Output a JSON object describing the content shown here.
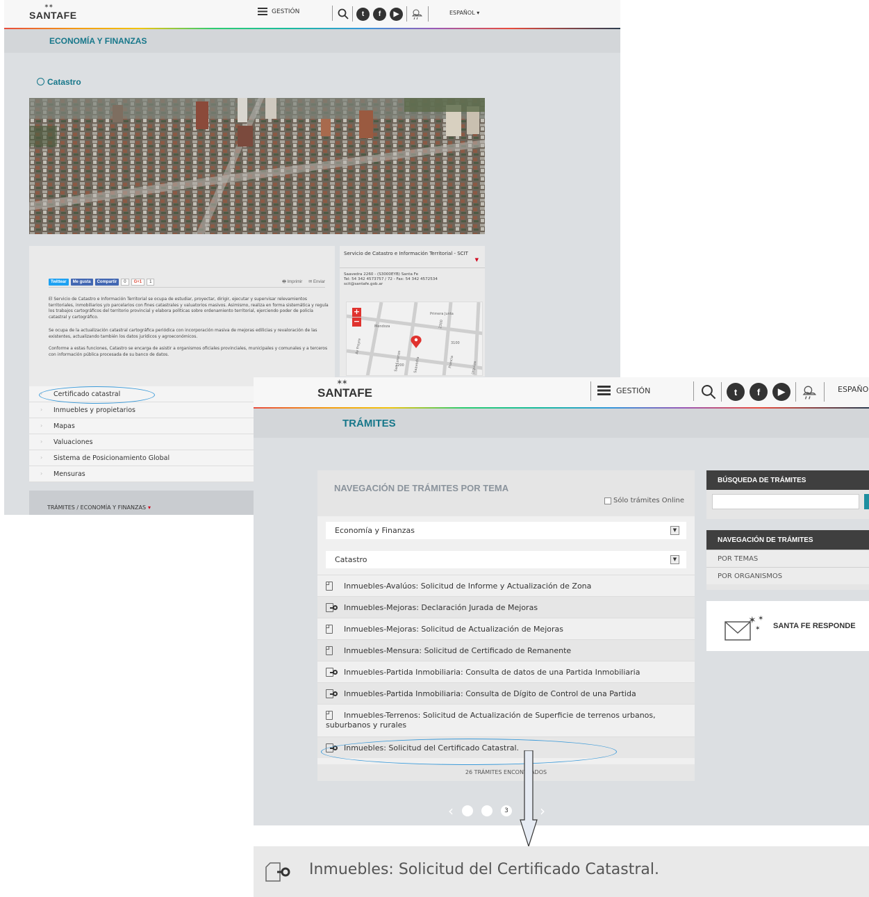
{
  "colors": {
    "teal": "#17778a",
    "panel": "#dcdfe2",
    "dark_header": "#3f3f3f",
    "red": "#d0021b",
    "annotation": "#3a9ad9"
  },
  "header": {
    "logo": "SANTAFE",
    "menu_label": "GESTIÓN",
    "language": "ESPAÑOL ▾",
    "language_short": "ESPAÑO",
    "icons": [
      "menu-icon",
      "search-icon",
      "twitter-icon",
      "facebook-icon",
      "youtube-icon",
      "weather-icon"
    ]
  },
  "page1": {
    "section": "ECONOMÍA Y FINANZAS",
    "breadcrumb": "Catastro",
    "share": {
      "tweet": "Twittear",
      "like": "Me gusta",
      "share": "Compartir",
      "share_count": "0",
      "gplus": "G+1",
      "gplus_count": "1",
      "print": "Imprimir",
      "send": "Enviar"
    },
    "paragraphs": [
      "El Servicio de Catastro e Información Territorial se ocupa de estudiar, proyectar, dirigir, ejecutar y supervisar relevamientos territoriales, inmobiliarios y/o parcelarios con fines catastrales y valuatorios masivos. Asimismo, realiza en forma sistemática y regula los trabajos cartográficos del territorio provincial y elabora políticas sobre ordenamiento territorial, ejerciendo poder de policía catastral y cartográfico.",
      "Se ocupa de la actualización catastral cartográfica periódica con incorporación masiva de mejoras edilicias y revaloración de las existentes, actualizando también los datos jurídicos y agroeconómicos.",
      "Conforme a estas funciones, Catastro se encarga de asistir a organismos oficiales provinciales, municipales y comunales y a terceros con información pública procesada de su banco de datos."
    ],
    "links": [
      "Certificado catastral",
      "Inmuebles y propietarios",
      "Mapas",
      "Valuaciones",
      "Sistema de Posicionamiento Global",
      "Mensuras"
    ],
    "tramites_bar": "TRÁMITES / ECONOMÍA Y FINANZAS",
    "side": {
      "title": "Servicio de Catastro e Información Territorial - SCIT",
      "address": "Saavedra 2260 - (S3000EYB) Santa Fe",
      "phone": "Tel: 54 342 4573757 / 72 - Fax: 54 342 4572534",
      "email": "scit@santafe.gob.ar",
      "streets": [
        "Mendoza",
        "Primera Junta",
        "San Lorenzo",
        "Saavedra",
        "Francia",
        "Urquiza",
        "Av Freyre",
        "3100",
        "2200",
        "2300"
      ],
      "zoom_in": "+",
      "zoom_out": "−"
    }
  },
  "page2": {
    "section": "TRÁMITES",
    "panel_title": "NAVEGACIÓN DE TRÁMITES POR TEMA",
    "online_only": "Sólo trámites Online",
    "select1": "Economía y Finanzas",
    "select2": "Catastro",
    "items": [
      {
        "text": "Inmuebles-Avalúos: Solicitud de Informe y Actualización de Zona",
        "icon": "document-icon"
      },
      {
        "text": "Inmuebles-Mejoras: Declaración Jurada de Mejoras",
        "icon": "online-document-icon"
      },
      {
        "text": "Inmuebles-Mejoras: Solicitud de Actualización de Mejoras",
        "icon": "document-icon"
      },
      {
        "text": "Inmuebles-Mensura: Solicitud de Certificado de Remanente",
        "icon": "document-icon"
      },
      {
        "text": "Inmuebles-Partida Inmobiliaria: Consulta de datos de una Partida Inmobiliaria",
        "icon": "online-document-icon"
      },
      {
        "text": "Inmuebles-Partida Inmobiliaria: Consulta de Dígito de Control de una Partida",
        "icon": "online-document-icon"
      },
      {
        "text": "Inmuebles-Terrenos: Solicitud de Actualización de Superficie de terrenos urbanos, suburbanos y rurales",
        "icon": "document-icon"
      },
      {
        "text": "Inmuebles: Solicitud del Certificado Catastral.",
        "icon": "online-document-icon"
      }
    ],
    "found": "26 TRÁMITES ENCONTRADOS",
    "pager": {
      "prev": "‹",
      "next": "›",
      "current": "3"
    },
    "search_title": "BÚSQUEDA DE TRÁMITES",
    "nav_title": "NAVEGACIÓN DE TRÁMITES",
    "nav_items": [
      "POR TEMAS",
      "POR ORGANISMOS"
    ],
    "responde": "SANTA FE RESPONDE"
  },
  "zoom": {
    "text": "Inmuebles: Solicitud del Certificado Catastral."
  }
}
